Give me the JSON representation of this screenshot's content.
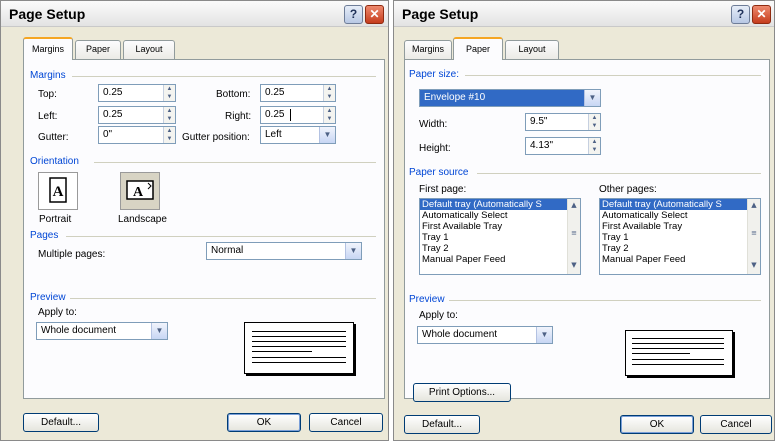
{
  "dialogs": [
    {
      "title": "Page Setup",
      "help_glyph": "?",
      "close_glyph": "✕",
      "tabs": [
        "Margins",
        "Paper",
        "Layout"
      ],
      "active_tab": "Margins",
      "margins": {
        "section": "Margins",
        "top_label": "Top:",
        "top_value": "0.25",
        "bottom_label": "Bottom:",
        "bottom_value": "0.25",
        "left_label": "Left:",
        "left_value": "0.25",
        "right_label": "Right:",
        "right_value": "0.25",
        "gutter_label": "Gutter:",
        "gutter_value": "0\"",
        "gutter_position_label": "Gutter position:",
        "gutter_position_value": "Left"
      },
      "orientation": {
        "section": "Orientation",
        "portrait_label": "Portrait",
        "landscape_label": "Landscape",
        "icon_letter": "A",
        "selected": "Landscape"
      },
      "pages": {
        "section": "Pages",
        "multiple_label": "Multiple pages:",
        "multiple_value": "Normal"
      },
      "preview": {
        "section": "Preview",
        "apply_label": "Apply to:",
        "apply_value": "Whole document"
      },
      "buttons": {
        "default": "Default...",
        "ok": "OK",
        "cancel": "Cancel"
      }
    },
    {
      "title": "Page Setup",
      "help_glyph": "?",
      "close_glyph": "✕",
      "tabs": [
        "Margins",
        "Paper",
        "Layout"
      ],
      "active_tab": "Paper",
      "paper_size": {
        "section": "Paper size:",
        "value": "Envelope #10",
        "width_label": "Width:",
        "width_value": "9.5\"",
        "height_label": "Height:",
        "height_value": "4.13\""
      },
      "paper_source": {
        "section": "Paper source",
        "first_page_label": "First page:",
        "other_pages_label": "Other pages:",
        "items": [
          "Default tray (Automatically S",
          "Automatically Select",
          "First Available Tray",
          "Tray 1",
          "Tray 2",
          "Manual Paper Feed"
        ],
        "selected_index": 0
      },
      "preview": {
        "section": "Preview",
        "apply_label": "Apply to:",
        "apply_value": "Whole document"
      },
      "print_options": "Print Options...",
      "buttons": {
        "default": "Default...",
        "ok": "OK",
        "cancel": "Cancel"
      }
    }
  ],
  "icons": {
    "spin_up": "▲",
    "spin_down": "▼",
    "dropdown": "▼",
    "scroll_up": "▲",
    "scroll_down": "▼",
    "scroll_grip": "≡"
  },
  "colors": {
    "dialog_bg": "#ece9d8",
    "panel_bg": "#fcfcfe",
    "section_text": "#0046d5",
    "active_tab_accent": "#f5a623",
    "selection": "#316ac5",
    "close_button": "#d9512b"
  }
}
